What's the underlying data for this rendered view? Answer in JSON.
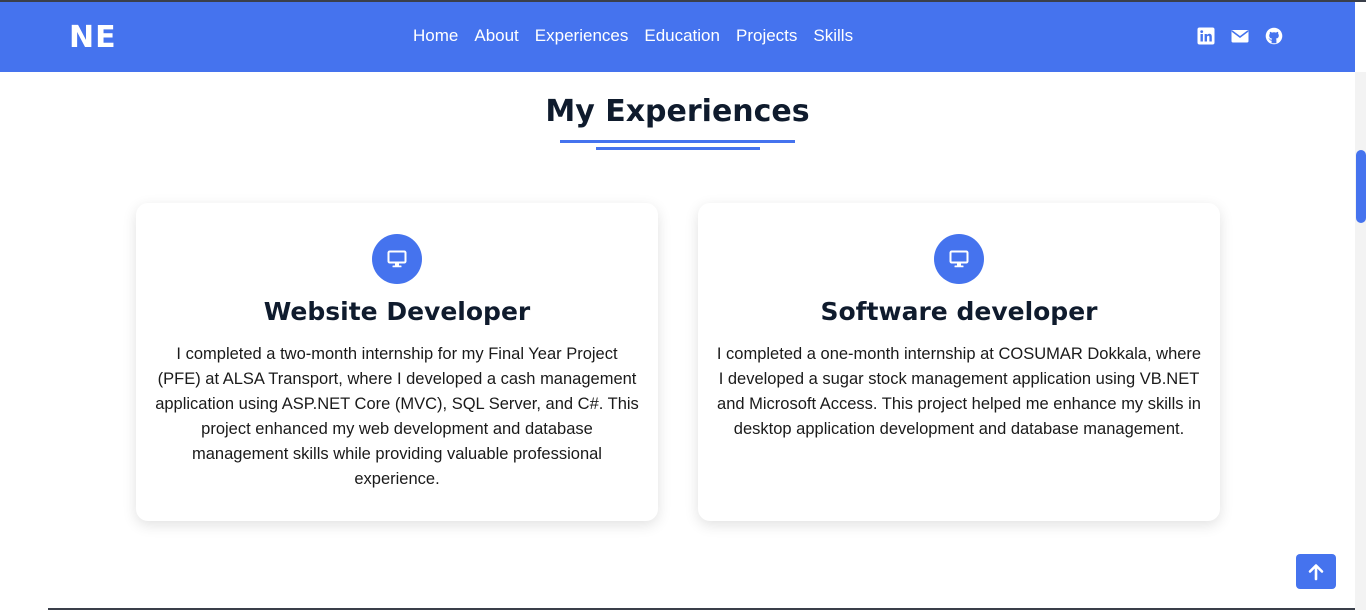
{
  "navbar": {
    "logo": "NE",
    "links": [
      "Home",
      "About",
      "Experiences",
      "Education",
      "Projects",
      "Skills"
    ],
    "socials": [
      "linkedin-icon",
      "envelope-icon",
      "github-icon"
    ],
    "background": "#4573ee"
  },
  "section": {
    "title": "My Experiences"
  },
  "cards": [
    {
      "icon": "desktop-icon",
      "title": "Website Developer",
      "text": "I completed a two-month internship for my Final Year Project (PFE) at ALSA Transport, where I developed a cash management application using ASP.NET Core (MVC), SQL Server, and C#. This project enhanced my web development and database management skills while providing valuable professional experience."
    },
    {
      "icon": "desktop-icon",
      "title": "Software developer",
      "text": "I completed a one-month internship at COSUMAR Dokkala, where I developed a sugar stock management application using VB.NET and Microsoft Access. This project helped me enhance my skills in desktop application development and database management."
    }
  ],
  "back_to_top": {
    "icon": "arrow-up-icon"
  },
  "colors": {
    "accent": "#4573ee",
    "heading": "#0f1b2d"
  }
}
